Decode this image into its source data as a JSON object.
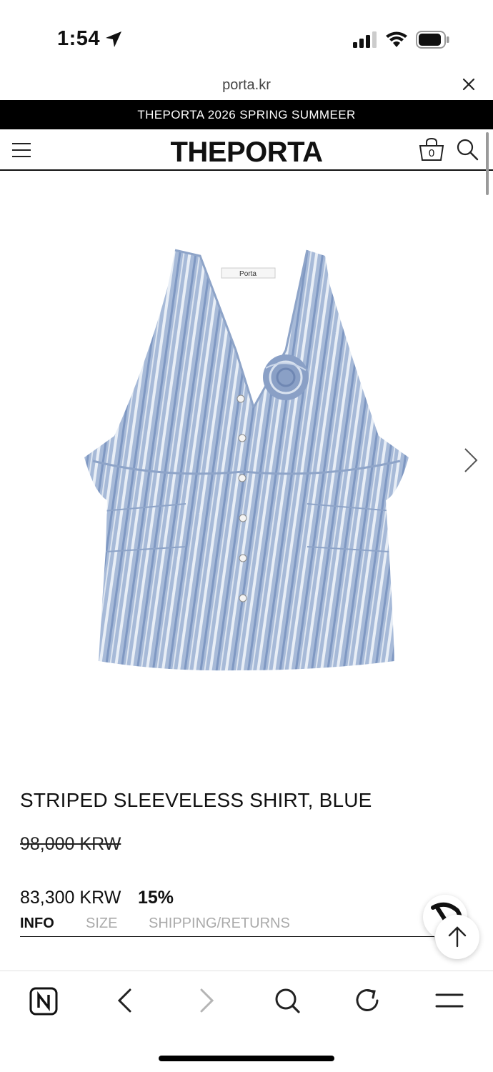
{
  "status_bar": {
    "time": "1:54"
  },
  "browser": {
    "url": "porta.kr"
  },
  "banner": {
    "text": "THEPORTA 2026 SPRING SUMMEER"
  },
  "site": {
    "logo": "THEPORTA",
    "cart_count": "0"
  },
  "product": {
    "name": "STRIPED SLEEVELESS SHIRT, BLUE",
    "original_price": "98,000 KRW",
    "sale_price": "83,300 KRW",
    "discount": "15%",
    "garment_label": "Porta",
    "image_icon": "striped-halter-shirt-image"
  },
  "tabs": [
    {
      "label": "INFO",
      "active": true
    },
    {
      "label": "SIZE",
      "active": false
    },
    {
      "label": "SHIPPING/RETURNS",
      "active": false
    }
  ],
  "colors": {
    "banner_bg": "#000000",
    "shirt_blue": "#9fb5d6",
    "tab_inactive": "#aaaaaa"
  },
  "toolbar_icons": [
    "naver-home-icon",
    "back-icon",
    "forward-icon",
    "search-icon",
    "reload-icon",
    "menu-icon"
  ]
}
